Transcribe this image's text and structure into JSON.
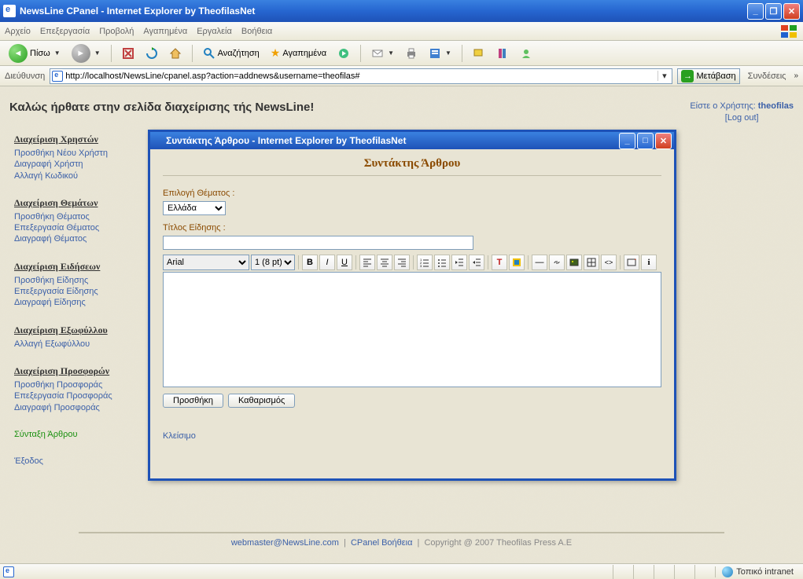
{
  "window": {
    "title": "NewsLine CPanel - Internet Explorer by TheofilasNet"
  },
  "menu": {
    "file": "Αρχείο",
    "edit": "Επεξεργασία",
    "view": "Προβολή",
    "favorites": "Αγαπημένα",
    "tools": "Εργαλεία",
    "help": "Βοήθεια"
  },
  "toolbar": {
    "back": "Πίσω",
    "search": "Αναζήτηση",
    "favorites": "Αγαπημένα"
  },
  "addressbar": {
    "label": "Διεύθυνση",
    "url": "http://localhost/NewsLine/cpanel.asp?action=addnews&username=theofilas#",
    "go": "Μετάβαση",
    "links": "Συνδέσεις"
  },
  "page": {
    "welcome": "Καλώς ήρθατε στην σελίδα διαχείρισης τής NewsLine!",
    "user_label": "Είστε ο Χρήστης:",
    "username": "theofilas",
    "logout": "Log out"
  },
  "sidebar": {
    "sections": [
      {
        "title": "Διαχείριση Χρηστών",
        "links": [
          "Προσθήκη Νέου Χρήστη",
          "Διαγραφή Χρήστη",
          "Αλλαγή Κωδικού"
        ]
      },
      {
        "title": "Διαχείριση Θεμάτων",
        "links": [
          "Προσθήκη Θέματος",
          "Επεξεργασία Θέματος",
          "Διαγραφή Θέματος"
        ]
      },
      {
        "title": "Διαχείριση Ειδήσεων",
        "links": [
          "Προσθήκη Είδησης",
          "Επεξεργασία Είδησης",
          "Διαγραφή Είδησης"
        ]
      },
      {
        "title": "Διαχείριση Εξωφύλλου",
        "links": [
          "Αλλαγή Εξωφύλλου"
        ]
      },
      {
        "title": "Διαχείριση Προσφορών",
        "links": [
          "Προσθήκη Προσφοράς",
          "Επεξεργασία Προσφοράς",
          "Διαγραφή Προσφοράς"
        ]
      }
    ],
    "compose": "Σύνταξη Άρθρου",
    "exit": "Έξοδος"
  },
  "popup": {
    "title": "Συντάκτης Άρθρου - Internet Explorer by TheofilasNet",
    "heading": "Συντάκτης Άρθρου",
    "topic_label": "Επιλογή Θέματος :",
    "topic_value": "Ελλάδα",
    "title_label": "Τίτλος Είδησης :",
    "title_value": "",
    "font": "Arial",
    "size": "1 (8 pt)",
    "add": "Προσθήκη",
    "clear": "Καθαρισμός",
    "close": "Κλείσιμο"
  },
  "footer": {
    "webmaster": "webmaster@NewsLine.com",
    "help": "CPanel Βοήθεια",
    "copyright": "Copyright @ 2007 Theofilas Press A.E"
  },
  "statusbar": {
    "zone": "Τοπικό intranet"
  }
}
